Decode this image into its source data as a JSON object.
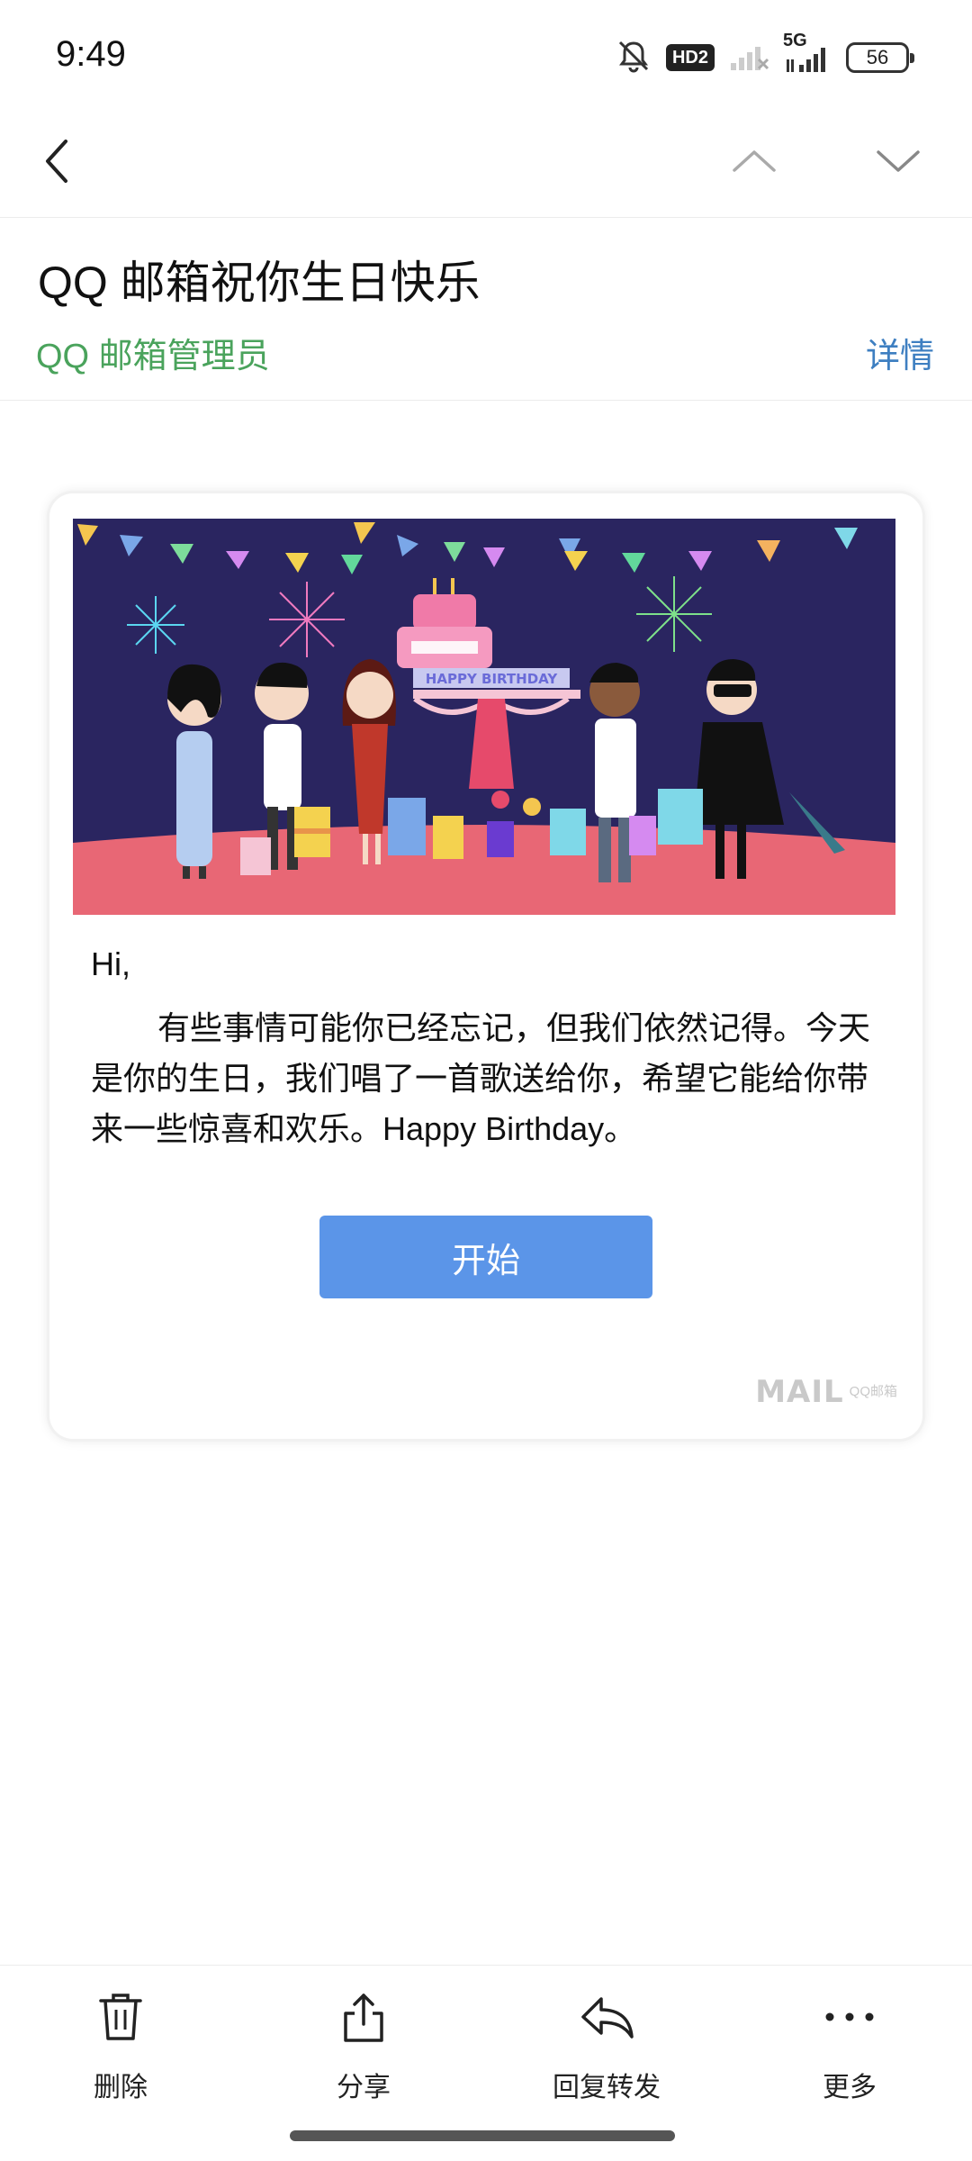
{
  "status_bar": {
    "time": "9:49",
    "hd_badge": "HD2",
    "network": "5G",
    "battery": "56",
    "icons": [
      "bell-mute-icon",
      "hd-badge",
      "signal-weak-icon",
      "signal-5g-icon",
      "battery-icon"
    ]
  },
  "nav": {
    "back_icon": "chevron-left-icon",
    "prev_icon": "chevron-up-icon",
    "next_icon": "chevron-down-icon"
  },
  "mail": {
    "title": "QQ 邮箱祝你生日快乐",
    "sender": "QQ 邮箱管理员",
    "detail": "详情",
    "sender_color": "#4aa35c",
    "detail_color": "#3e7fc1"
  },
  "card": {
    "banner_text": "HAPPY BIRTHDAY",
    "greeting": "Hi,",
    "body": "有些事情可能你已经忘记，但我们依然记得。今天是你的生日，我们唱了一首歌送给你，希望它能给你带来一些惊喜和欢乐。Happy Birthday。",
    "button_label": "开始",
    "button_color": "#5b95e8",
    "logo_word": "MAIL",
    "logo_sub": "QQ邮箱"
  },
  "toolbar": {
    "items": [
      {
        "label": "删除",
        "icon": "trash-icon"
      },
      {
        "label": "分享",
        "icon": "share-icon"
      },
      {
        "label": "回复转发",
        "icon": "reply-icon"
      },
      {
        "label": "更多",
        "icon": "more-icon"
      }
    ]
  }
}
